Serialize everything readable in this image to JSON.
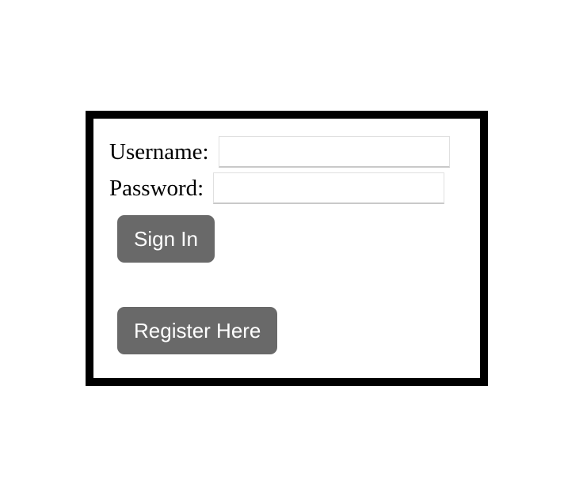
{
  "form": {
    "username_label": "Username:",
    "username_value": "",
    "password_label": "Password:",
    "password_value": "",
    "sign_in_label": "Sign In",
    "register_label": "Register Here"
  },
  "colors": {
    "frame": "#000000",
    "button_bg": "#696969",
    "button_text": "#ffffff"
  }
}
